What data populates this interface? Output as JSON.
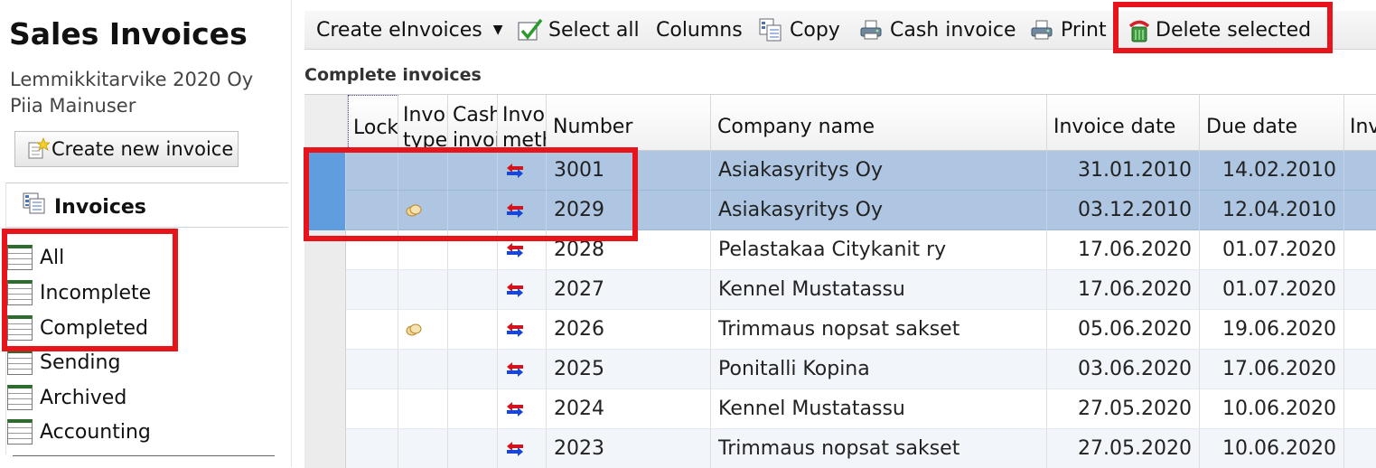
{
  "sidebar": {
    "title": "Sales Invoices",
    "company": "Lemmikkitarvike 2020 Oy",
    "user": "Piia Mainuser",
    "create_button": "Create new invoice",
    "nav_header": "Invoices",
    "items": [
      {
        "label": "All"
      },
      {
        "label": "Incomplete"
      },
      {
        "label": "Completed"
      },
      {
        "label": "Sending"
      },
      {
        "label": "Archived"
      },
      {
        "label": "Accounting"
      }
    ]
  },
  "toolbar": {
    "create_einvoices": "Create eInvoices",
    "select_all": "Select all",
    "columns": "Columns",
    "copy": "Copy",
    "cash_invoice": "Cash invoice",
    "print": "Print",
    "delete_selected": "Delete selected"
  },
  "section_title": "Complete invoices",
  "table": {
    "headers": {
      "lock": "Lock",
      "invoice_type": [
        "Invoi",
        "type"
      ],
      "cash_invoice": [
        "Cash",
        "invoi"
      ],
      "invoice_method": [
        "Invoi",
        "meth"
      ],
      "number": "Number",
      "company": "Company name",
      "invoice_date": "Invoice date",
      "due_date": "Due date",
      "extra": "Inv"
    },
    "rows": [
      {
        "number": "3001",
        "company": "Asiakasyritys Oy",
        "invoice_date": "31.01.2010",
        "due_date": "14.02.2010",
        "type_icon": "",
        "selected": true
      },
      {
        "number": "2029",
        "company": "Asiakasyritys Oy",
        "invoice_date": "03.12.2010",
        "due_date": "12.04.2010",
        "type_icon": "coins-icon",
        "selected": true
      },
      {
        "number": "2028",
        "company": "Pelastakaa Citykanit ry",
        "invoice_date": "17.06.2020",
        "due_date": "01.07.2020",
        "type_icon": "",
        "selected": false
      },
      {
        "number": "2027",
        "company": "Kennel Mustatassu",
        "invoice_date": "17.06.2020",
        "due_date": "01.07.2020",
        "type_icon": "",
        "selected": false
      },
      {
        "number": "2026",
        "company": "Trimmaus nopsat sakset",
        "invoice_date": "05.06.2020",
        "due_date": "19.06.2020",
        "type_icon": "coins-icon",
        "selected": false
      },
      {
        "number": "2025",
        "company": "Ponitalli Kopina",
        "invoice_date": "03.06.2020",
        "due_date": "17.06.2020",
        "type_icon": "",
        "selected": false
      },
      {
        "number": "2024",
        "company": "Kennel Mustatassu",
        "invoice_date": "27.05.2020",
        "due_date": "10.06.2020",
        "type_icon": "",
        "selected": false
      },
      {
        "number": "2023",
        "company": "Trimmaus nopsat sakset",
        "invoice_date": "27.05.2020",
        "due_date": "10.06.2020",
        "type_icon": "",
        "selected": false
      }
    ]
  },
  "colors": {
    "highlight": "#e8141c",
    "selected_row": "#aec6e2",
    "row_marker": "#5f9ddf"
  }
}
